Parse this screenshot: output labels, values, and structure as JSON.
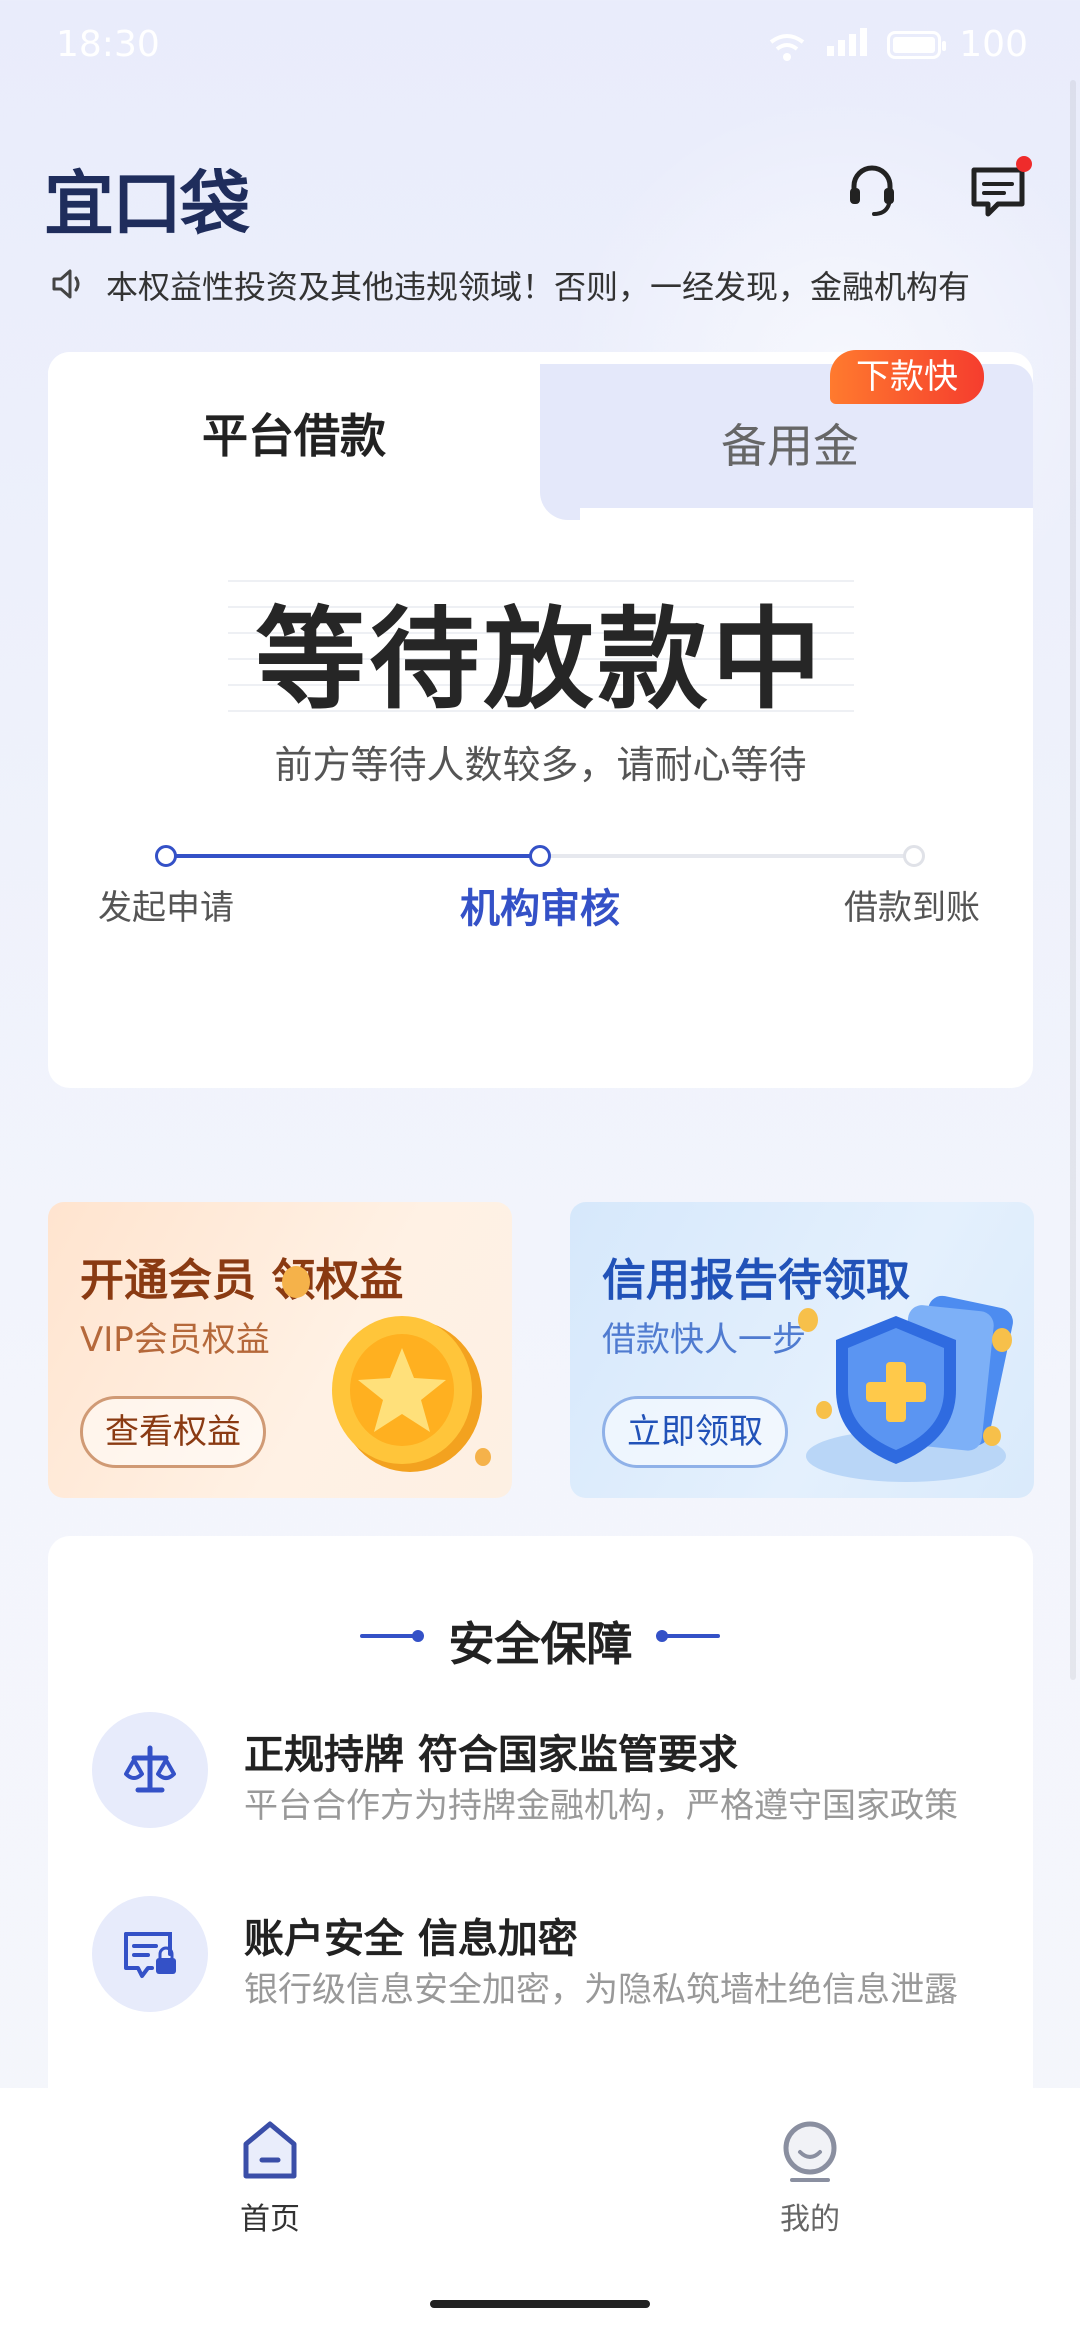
{
  "status_bar": {
    "time": "18:30",
    "battery": "100"
  },
  "app": {
    "logo": "宜口袋"
  },
  "notice": {
    "text": "本权益性投资及其他违规领域！否则，一经发现，金融机构有"
  },
  "tabs": [
    {
      "label": "平台借款",
      "active": true
    },
    {
      "label": "备用金",
      "active": false,
      "badge": "下款快"
    }
  ],
  "loan_status": {
    "title": "等待放款中",
    "subtitle": "前方等待人数较多，请耐心等待",
    "steps": [
      {
        "label": "发起申请",
        "state": "done"
      },
      {
        "label": "机构审核",
        "state": "current"
      },
      {
        "label": "借款到账",
        "state": "pending"
      }
    ]
  },
  "promos": {
    "vip": {
      "title": "开通会员 领权益",
      "subtitle": "VIP会员权益",
      "button": "查看权益"
    },
    "credit": {
      "title": "信用报告待领取",
      "subtitle": "借款快人一步",
      "button": "立即领取"
    }
  },
  "safety": {
    "title": "安全保障",
    "features": [
      {
        "icon": "scale-icon",
        "title": "正规持牌 符合国家监管要求",
        "desc": "平台合作方为持牌金融机构，严格遵守国家政策"
      },
      {
        "icon": "secure-card-icon",
        "title": "账户安全 信息加密",
        "desc": "银行级信息安全加密，为隐私筑墙杜绝信息泄露"
      }
    ]
  },
  "nav": [
    {
      "label": "首页",
      "icon": "home-icon",
      "active": true
    },
    {
      "label": "我的",
      "icon": "profile-icon",
      "active": false
    }
  ],
  "colors": {
    "accent": "#3451c7",
    "badge": "#f5522e",
    "vip_text": "#8a3a12",
    "credit_text": "#2152b8"
  }
}
